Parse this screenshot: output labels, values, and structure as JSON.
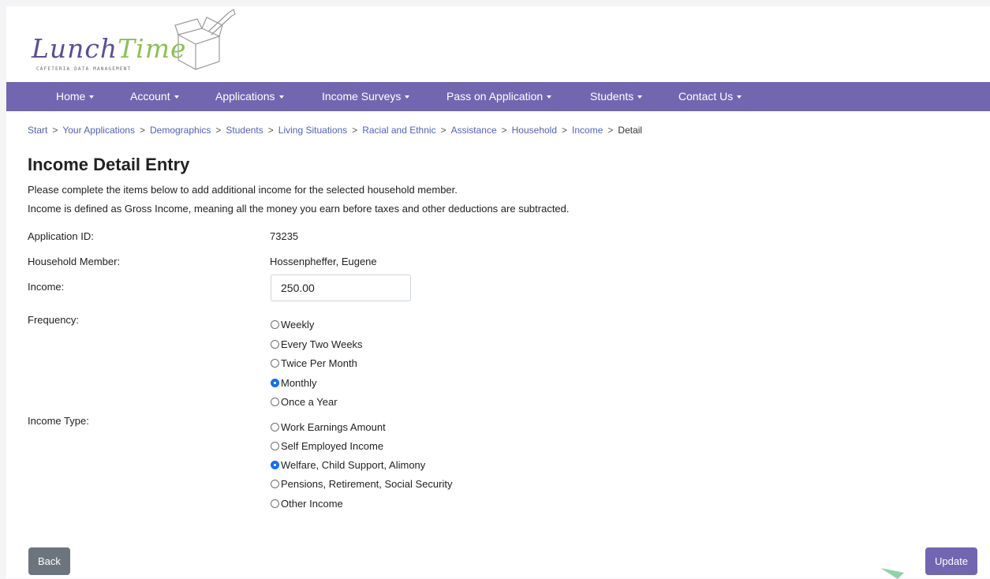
{
  "brand": {
    "logo_word1": "Lunch",
    "logo_word2": "Time",
    "logo_tagline": "CAFETERIA DATA MANAGEMENT"
  },
  "nav": {
    "items": [
      {
        "label": "Home"
      },
      {
        "label": "Account"
      },
      {
        "label": "Applications"
      },
      {
        "label": "Income Surveys"
      },
      {
        "label": "Pass on Application"
      },
      {
        "label": "Students"
      },
      {
        "label": "Contact Us"
      }
    ]
  },
  "breadcrumb": {
    "items": [
      "Start",
      "Your Applications",
      "Demographics",
      "Students",
      "Living Situations",
      "Racial and Ethnic",
      "Assistance",
      "Household",
      "Income",
      "Detail"
    ],
    "separator": ">"
  },
  "page": {
    "title": "Income Detail Entry",
    "intro_line1": "Please complete the items below to add additional income for the selected household member.",
    "intro_line2": "Income is defined as Gross Income, meaning all the money you earn before taxes and other deductions are subtracted."
  },
  "form": {
    "application_id_label": "Application ID:",
    "application_id_value": "73235",
    "household_member_label": "Household Member:",
    "household_member_value": "Hossenpheffer, Eugene",
    "income_label": "Income:",
    "income_value": "250.00",
    "frequency_label": "Frequency:",
    "frequency_options": [
      "Weekly",
      "Every Two Weeks",
      "Twice Per Month",
      "Monthly",
      "Once a Year"
    ],
    "frequency_selected": "Monthly",
    "income_type_label": "Income Type:",
    "income_type_options": [
      "Work Earnings Amount",
      "Self Employed Income",
      "Welfare, Child Support, Alimony",
      "Pensions, Retirement, Social Security",
      "Other Income"
    ],
    "income_type_selected": "Welfare, Child Support, Alimony"
  },
  "buttons": {
    "back": "Back",
    "update": "Update"
  },
  "colors": {
    "nav_bg": "#7266b0",
    "link": "#4f63b8",
    "back_btn": "#6c757d",
    "update_btn": "#7266b0",
    "radio_checked": "#0d6efd"
  }
}
